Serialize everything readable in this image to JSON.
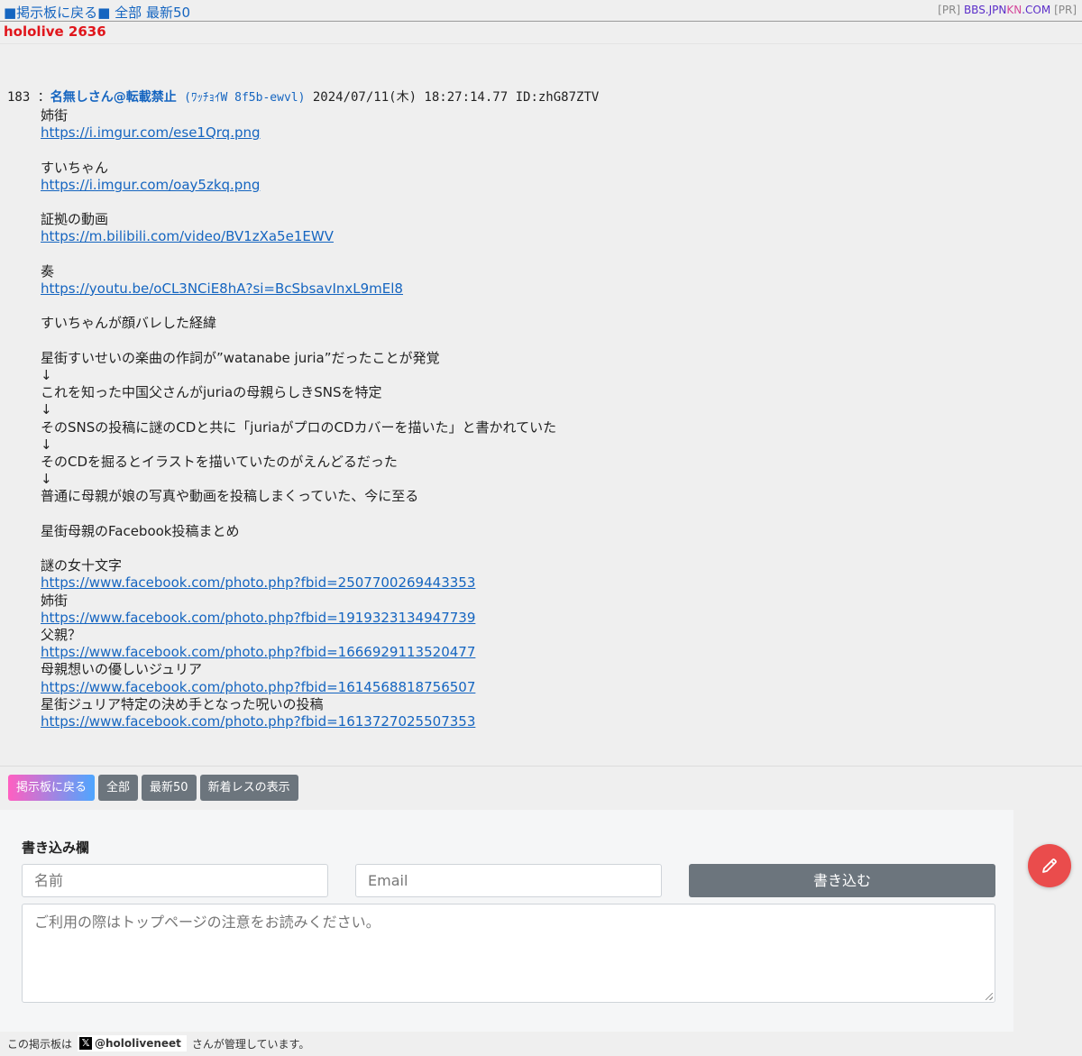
{
  "topbar": {
    "back_link": "■掲示板に戻る■",
    "all_link": "全部",
    "latest_link": "最新50",
    "pr_left": "[PR]",
    "pr_domain_1": "BBS.JPN",
    "pr_domain_2": "KN",
    "pr_domain_3": ".COM",
    "pr_right": "[PR]"
  },
  "board_title": "hololive 2636",
  "post": {
    "number": "183",
    "sep": "：",
    "name": "名無しさん@転載禁止",
    "trip": "(ﾜｯﾁｮｲW 8f5b-ewvl)",
    "datetime": "2024/07/11(木) 18:27:14.77",
    "id": "ID:zhG87ZTV",
    "lines": [
      {
        "t": "text",
        "v": "姉街"
      },
      {
        "t": "link",
        "v": "https://i.imgur.com/ese1Qrq.png"
      },
      {
        "t": "blank",
        "v": ""
      },
      {
        "t": "text",
        "v": "すいちゃん"
      },
      {
        "t": "link",
        "v": "https://i.imgur.com/oay5zkq.png"
      },
      {
        "t": "blank",
        "v": ""
      },
      {
        "t": "text",
        "v": "証拠の動画"
      },
      {
        "t": "link",
        "v": "https://m.bilibili.com/video/BV1zXa5e1EWV"
      },
      {
        "t": "blank",
        "v": ""
      },
      {
        "t": "text",
        "v": "奏"
      },
      {
        "t": "link",
        "v": "https://youtu.be/oCL3NCiE8hA?si=BcSbsavInxL9mEl8"
      },
      {
        "t": "blank",
        "v": ""
      },
      {
        "t": "text",
        "v": "すいちゃんが顔バレした経緯"
      },
      {
        "t": "blank",
        "v": ""
      },
      {
        "t": "text",
        "v": "星街すいせいの楽曲の作詞が”watanabe juria”だったことが発覚"
      },
      {
        "t": "text",
        "v": "↓"
      },
      {
        "t": "text",
        "v": "これを知った中国父さんがjuriaの母親らしきSNSを特定"
      },
      {
        "t": "text",
        "v": "↓"
      },
      {
        "t": "text",
        "v": "そのSNSの投稿に謎のCDと共に「juriaがプロのCDカバーを描いた」と書かれていた"
      },
      {
        "t": "text",
        "v": "↓"
      },
      {
        "t": "text",
        "v": "そのCDを掘るとイラストを描いていたのがえんどるだった"
      },
      {
        "t": "text",
        "v": "↓"
      },
      {
        "t": "text",
        "v": "普通に母親が娘の写真や動画を投稿しまくっていた、今に至る"
      },
      {
        "t": "blank",
        "v": ""
      },
      {
        "t": "text",
        "v": "星街母親のFacebook投稿まとめ"
      },
      {
        "t": "blank",
        "v": ""
      },
      {
        "t": "text",
        "v": "謎の女十文字"
      },
      {
        "t": "link",
        "v": "https://www.facebook.com/photo.php?fbid=2507700269443353"
      },
      {
        "t": "text",
        "v": "姉街"
      },
      {
        "t": "link",
        "v": "https://www.facebook.com/photo.php?fbid=1919323134947739"
      },
      {
        "t": "text",
        "v": "父親？"
      },
      {
        "t": "link",
        "v": "https://www.facebook.com/photo.php?fbid=1666929113520477"
      },
      {
        "t": "text",
        "v": "母親想いの優しいジュリア"
      },
      {
        "t": "link",
        "v": "https://www.facebook.com/photo.php?fbid=1614568818756507"
      },
      {
        "t": "text",
        "v": "星街ジュリア特定の決め手となった呪いの投稿"
      },
      {
        "t": "link",
        "v": "https://www.facebook.com/photo.php?fbid=1613727025507353"
      }
    ]
  },
  "nav_buttons": {
    "back": "掲示板に戻る",
    "all": "全部",
    "latest": "最新50",
    "new_replies": "新着レスの表示"
  },
  "form": {
    "title": "書き込み欄",
    "name_placeholder": "名前",
    "email_placeholder": "Email",
    "submit_label": "書き込む",
    "message_placeholder": "ご利用の際はトップページの注意をお読みください。"
  },
  "fab_icon": "pencil-icon",
  "footer": {
    "prefix": "この掲示板は",
    "x_logo": "𝕏",
    "handle": "@hololiveneet",
    "suffix": "さんが管理しています。"
  },
  "colors": {
    "link": "#1565c0",
    "board_title": "#e0161c",
    "button_gray": "#6c757d",
    "fab": "#ea4c4c"
  }
}
